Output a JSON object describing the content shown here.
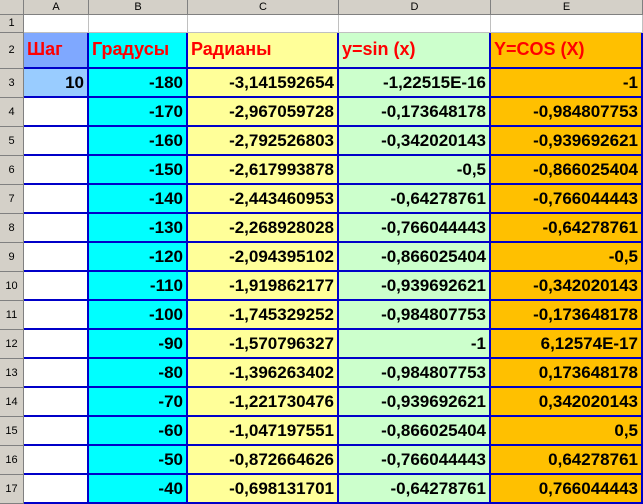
{
  "columns": [
    "A",
    "B",
    "C",
    "D",
    "E"
  ],
  "header_row": {
    "row_number": "2",
    "A": "Шаг",
    "B": "Градусы",
    "C": "Радианы",
    "D": "y=sin (x)",
    "E": "Y=COS (X)"
  },
  "empty_row_number": "1",
  "step_value": "10",
  "rows": [
    {
      "n": "3",
      "deg": "-180",
      "rad": "-3,141592654",
      "sin": "-1,22515E-16",
      "cos": "-1"
    },
    {
      "n": "4",
      "deg": "-170",
      "rad": "-2,967059728",
      "sin": "-0,173648178",
      "cos": "-0,984807753"
    },
    {
      "n": "5",
      "deg": "-160",
      "rad": "-2,792526803",
      "sin": "-0,342020143",
      "cos": "-0,939692621"
    },
    {
      "n": "6",
      "deg": "-150",
      "rad": "-2,617993878",
      "sin": "-0,5",
      "cos": "-0,866025404"
    },
    {
      "n": "7",
      "deg": "-140",
      "rad": "-2,443460953",
      "sin": "-0,64278761",
      "cos": "-0,766044443"
    },
    {
      "n": "8",
      "deg": "-130",
      "rad": "-2,268928028",
      "sin": "-0,766044443",
      "cos": "-0,64278761"
    },
    {
      "n": "9",
      "deg": "-120",
      "rad": "-2,094395102",
      "sin": "-0,866025404",
      "cos": "-0,5"
    },
    {
      "n": "10",
      "deg": "-110",
      "rad": "-1,919862177",
      "sin": "-0,939692621",
      "cos": "-0,342020143"
    },
    {
      "n": "11",
      "deg": "-100",
      "rad": "-1,745329252",
      "sin": "-0,984807753",
      "cos": "-0,173648178"
    },
    {
      "n": "12",
      "deg": "-90",
      "rad": "-1,570796327",
      "sin": "-1",
      "cos": "6,12574E-17"
    },
    {
      "n": "13",
      "deg": "-80",
      "rad": "-1,396263402",
      "sin": "-0,984807753",
      "cos": "0,173648178"
    },
    {
      "n": "14",
      "deg": "-70",
      "rad": "-1,221730476",
      "sin": "-0,939692621",
      "cos": "0,342020143"
    },
    {
      "n": "15",
      "deg": "-60",
      "rad": "-1,047197551",
      "sin": "-0,866025404",
      "cos": "0,5"
    },
    {
      "n": "16",
      "deg": "-50",
      "rad": "-0,872664626",
      "sin": "-0,766044443",
      "cos": "0,64278761"
    },
    {
      "n": "17",
      "deg": "-40",
      "rad": "-0,698131701",
      "sin": "-0,64278761",
      "cos": "0,766044443"
    }
  ]
}
